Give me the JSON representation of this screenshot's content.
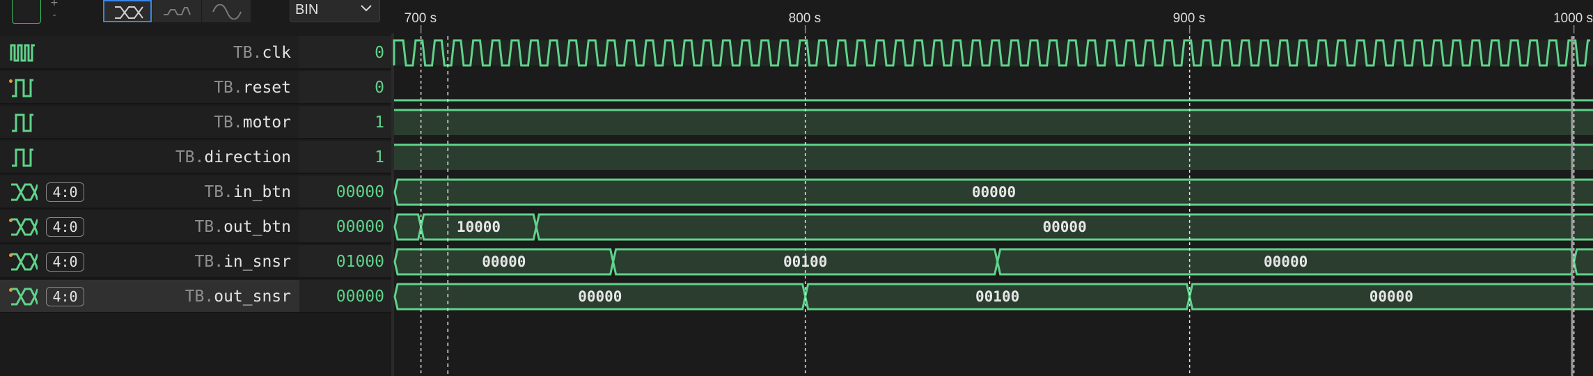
{
  "toolbar": {
    "zoom_in": "+",
    "zoom_out": "-",
    "radix": "BIN",
    "modes": [
      "bus-view",
      "analog-step",
      "analog-smooth"
    ]
  },
  "timeline": {
    "ticks": [
      {
        "time": 700,
        "label": "700 s"
      },
      {
        "time": 800,
        "label": "800 s"
      },
      {
        "time": 900,
        "label": "900 s"
      },
      {
        "time": 1000,
        "label": "1000 s"
      }
    ],
    "cursor_time": 707
  },
  "colors": {
    "wave": "#5fd38a",
    "wave_fill": "#2a3d2f",
    "cursor": "#e8e8e8",
    "selection": "#3a86e6"
  },
  "signals": [
    {
      "prefix": "TB.",
      "name": "clk",
      "value": "0",
      "kind": "clock",
      "icon": "clock-icon"
    },
    {
      "prefix": "TB.",
      "name": "reset",
      "value": "0",
      "kind": "bit",
      "icon": "pulse-icon",
      "marked": true,
      "level": 0
    },
    {
      "prefix": "TB.",
      "name": "motor",
      "value": "1",
      "kind": "bit",
      "icon": "pulse-icon",
      "level": 1
    },
    {
      "prefix": "TB.",
      "name": "direction",
      "value": "1",
      "kind": "bit",
      "icon": "pulse-icon",
      "level": 1
    },
    {
      "prefix": "TB.",
      "name": "in_btn",
      "value": "00000",
      "kind": "bus",
      "icon": "bus-icon",
      "width": "4:0",
      "segments": [
        {
          "from": 693,
          "to": 1006,
          "label": "00000"
        }
      ]
    },
    {
      "prefix": "TB.",
      "name": "out_btn",
      "value": "00000",
      "kind": "bus",
      "icon": "bus-icon",
      "width": "4:0",
      "marked": true,
      "segments": [
        {
          "from": 693,
          "to": 700,
          "label": ""
        },
        {
          "from": 700,
          "to": 730,
          "label": "10000"
        },
        {
          "from": 730,
          "to": 1006,
          "label": "00000"
        }
      ]
    },
    {
      "prefix": "TB.",
      "name": "in_snsr",
      "value": "01000",
      "kind": "bus",
      "icon": "bus-icon",
      "width": "4:0",
      "marked": true,
      "segments": [
        {
          "from": 693,
          "to": 750,
          "label": "00000"
        },
        {
          "from": 750,
          "to": 850,
          "label": "00100"
        },
        {
          "from": 850,
          "to": 1000,
          "label": "00000"
        },
        {
          "from": 1000,
          "to": 1006,
          "label": ""
        }
      ]
    },
    {
      "prefix": "TB.",
      "name": "out_snsr",
      "value": "00000",
      "kind": "bus",
      "icon": "bus-icon",
      "width": "4:0",
      "marked": true,
      "selected": true,
      "segments": [
        {
          "from": 693,
          "to": 800,
          "label": "00000"
        },
        {
          "from": 800,
          "to": 900,
          "label": "00100"
        },
        {
          "from": 900,
          "to": 1006,
          "label": "00000"
        }
      ]
    }
  ]
}
